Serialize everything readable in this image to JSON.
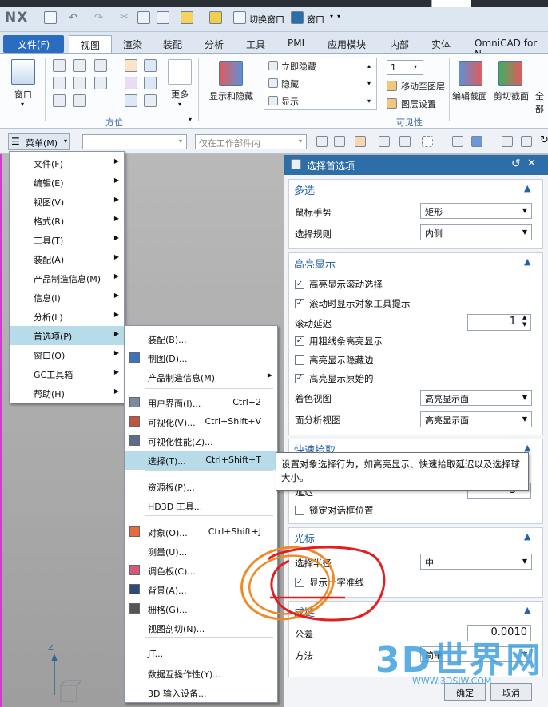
{
  "app": {
    "logo": "NX",
    "quick_switch_window": "切换窗口",
    "quick_window": "窗口"
  },
  "tabs": [
    {
      "label": "文件(F)"
    },
    {
      "label": "视图"
    },
    {
      "label": "渲染"
    },
    {
      "label": "装配"
    },
    {
      "label": "分析"
    },
    {
      "label": "工具"
    },
    {
      "label": "PMI"
    },
    {
      "label": "应用模块"
    },
    {
      "label": "内部"
    },
    {
      "label": "实体"
    },
    {
      "label": "OmniCAD for N"
    }
  ],
  "ribbon": {
    "window_label": "窗口",
    "more_label": "更多",
    "orientation_group": "方位",
    "show_hide_label": "显示和隐藏",
    "immediate_hide": "立即隐藏",
    "hide": "隐藏",
    "show": "显示",
    "layer_value": "1",
    "move_to_layer": "移动至图层",
    "layer_settings": "图层设置",
    "visibility_group": "可见性",
    "edit_section": "编辑截面",
    "clip_section": "剪切截面",
    "full_label": "全部"
  },
  "filterbar": {
    "menu_button": "菜单(M)",
    "filter_value": "",
    "scope_placeholder": "仅在工作部件内"
  },
  "main_menu": [
    {
      "label": "文件(F)"
    },
    {
      "label": "编辑(E)"
    },
    {
      "label": "视图(V)"
    },
    {
      "label": "格式(R)"
    },
    {
      "label": "工具(T)"
    },
    {
      "label": "装配(A)"
    },
    {
      "label": "产品制造信息(M)"
    },
    {
      "label": "信息(I)"
    },
    {
      "label": "分析(L)"
    },
    {
      "label": "首选项(P)"
    },
    {
      "label": "窗口(O)"
    },
    {
      "label": "GC工具箱"
    },
    {
      "label": "帮助(H)"
    }
  ],
  "sub_menu": [
    {
      "label": "装配(B)...",
      "shortcut": ""
    },
    {
      "label": "制图(D)...",
      "shortcut": ""
    },
    {
      "label": "产品制造信息(M)",
      "shortcut": ""
    },
    {
      "label": "用户界面(I)...",
      "shortcut": "Ctrl+2"
    },
    {
      "label": "可视化(V)...",
      "shortcut": "Ctrl+Shift+V"
    },
    {
      "label": "可视化性能(Z)...",
      "shortcut": ""
    },
    {
      "label": "选择(T)...",
      "shortcut": "Ctrl+Shift+T"
    },
    {
      "label": "资源板(P)...",
      "shortcut": ""
    },
    {
      "label": "HD3D 工具...",
      "shortcut": ""
    },
    {
      "label": "对象(O)...",
      "shortcut": "Ctrl+Shift+J"
    },
    {
      "label": "测量(U)...",
      "shortcut": ""
    },
    {
      "label": "调色板(C)...",
      "shortcut": ""
    },
    {
      "label": "背景(A)...",
      "shortcut": ""
    },
    {
      "label": "栅格(G)...",
      "shortcut": ""
    },
    {
      "label": "视图剖切(N)...",
      "shortcut": ""
    },
    {
      "label": "JT...",
      "shortcut": ""
    },
    {
      "label": "数据互操作性(Y)...",
      "shortcut": ""
    },
    {
      "label": "3D 输入设备...",
      "shortcut": ""
    }
  ],
  "tooltip": "设置对象选择行为，如高亮显示、快速拾取延迟以及选择球大小。",
  "dialog": {
    "title": "选择首选项",
    "multi_select": {
      "title": "多选",
      "mouse_gesture_label": "鼠标手势",
      "mouse_gesture_value": "矩形",
      "select_rule_label": "选择规则",
      "select_rule_value": "内侧"
    },
    "highlight": {
      "title": "高亮显示",
      "hl_scroll": "高亮显示滚动选择",
      "scroll_tooltip": "滚动时显示对象工具提示",
      "scroll_delay_label": "滚动延迟",
      "scroll_delay_value": "1",
      "thick_lines": "用粗线条高亮显示",
      "hl_hidden_edges": "高亮显示隐藏边",
      "hl_original": "高亮显示原始的",
      "shaded_view_label": "着色视图",
      "shaded_view_value": "高亮显示面",
      "face_analysis_label": "面分析视图",
      "face_analysis_value": "高亮显示面"
    },
    "quick_pick": {
      "title": "快速拾取",
      "delay_label": "延迟",
      "delay_value": "3",
      "lock_dialog": "锁定对话框位置"
    },
    "cursor": {
      "title": "光标",
      "radius_label": "选择半径",
      "radius_value": "中",
      "crosshair": "显示十字准线"
    },
    "chaining": {
      "title": "成链",
      "tolerance_label": "公差",
      "tolerance_value": "0.0010",
      "method_label": "方法",
      "method_value": "简单"
    },
    "ok": "确定",
    "cancel": "取消"
  },
  "watermark": {
    "text": "3D世界网",
    "url": "WWW.3DSJW.COM"
  },
  "axis": {
    "z": "Z"
  }
}
